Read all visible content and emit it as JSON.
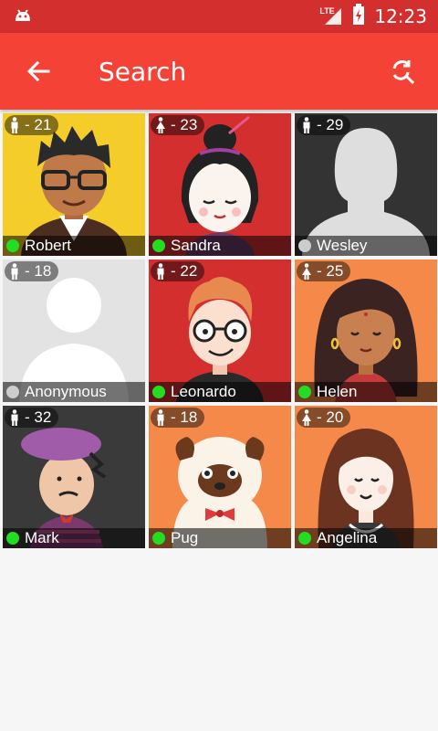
{
  "status_bar": {
    "network": "LTE",
    "time": "12:23"
  },
  "app_bar": {
    "title": "Search"
  },
  "colors": {
    "status_bar": "#d32f2f",
    "app_bar": "#f44336",
    "online": "#22dd22",
    "offline": "#cccccc"
  },
  "users": [
    {
      "name": "Robert",
      "age": "- 21",
      "gender": "male",
      "online": true,
      "bg": "#f5cd2a"
    },
    {
      "name": "Sandra",
      "age": "- 23",
      "gender": "female",
      "online": true,
      "bg": "#d32f2f"
    },
    {
      "name": "Wesley",
      "age": "- 29",
      "gender": "male",
      "online": false,
      "bg": "#333333"
    },
    {
      "name": "Anonymous",
      "age": "- 18",
      "gender": "male",
      "online": false,
      "bg": "#e3e3e3"
    },
    {
      "name": "Leonardo",
      "age": "- 22",
      "gender": "male",
      "online": true,
      "bg": "#d32f2f"
    },
    {
      "name": "Helen",
      "age": "- 25",
      "gender": "female",
      "online": true,
      "bg": "#f5894a"
    },
    {
      "name": "Mark",
      "age": "- 32",
      "gender": "male",
      "online": true,
      "bg": "#3a3a3a"
    },
    {
      "name": "Pug",
      "age": "- 18",
      "gender": "male",
      "online": true,
      "bg": "#f5894a"
    },
    {
      "name": "Angelina",
      "age": "- 20",
      "gender": "female",
      "online": true,
      "bg": "#f5894a"
    }
  ]
}
